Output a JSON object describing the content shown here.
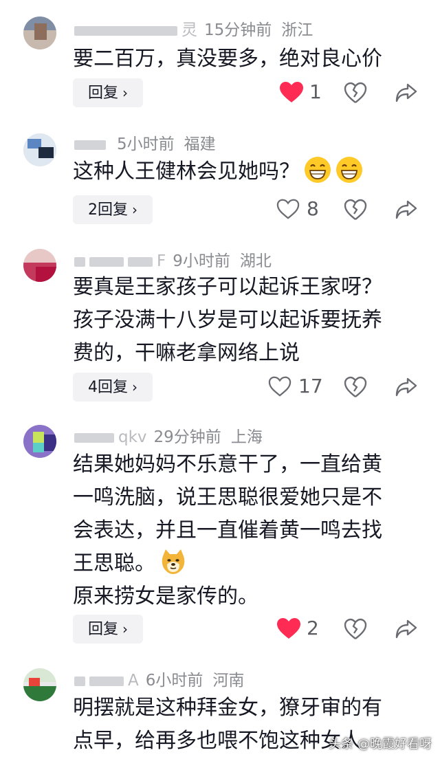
{
  "comments": [
    {
      "name_tail": "灵",
      "time": "15分钟前",
      "location": "浙江",
      "lines": [
        "要二百万，真没要多，绝对良心价"
      ],
      "reply_label": "回复",
      "likes": "1",
      "liked": true
    },
    {
      "name_tail": "",
      "time": "5小时前",
      "location": "福建",
      "lines": [
        "这种人王健林会见她吗？"
      ],
      "emoji": "grin-emoji",
      "reply_label": "2回复",
      "likes": "8",
      "liked": false
    },
    {
      "name_tail": "F",
      "time": "9小时前",
      "location": "湖北",
      "lines": [
        "要真是王家孩子可以起诉王家呀？",
        "孩子没满十八岁是可以起诉要抚养",
        "费的，干嘛老拿网络上说"
      ],
      "reply_label": "4回复",
      "likes": "17",
      "liked": false
    },
    {
      "name_tail": "qkv",
      "time": "29分钟前",
      "location": "上海",
      "lines": [
        "结果她妈妈不乐意干了，一直给黄",
        "一鸣洗脑，说王思聪很爱她只是不",
        "会表达，并且一直催着黄一鸣去找",
        "王思聪。",
        "原来捞女是家传的。"
      ],
      "emoji": "doge-emoji",
      "reply_label": "回复",
      "likes": "2",
      "liked": true
    },
    {
      "name_tail": "A",
      "time": "6小时前",
      "location": "河南",
      "lines": [
        "明摆就是这种拜金女，獠牙审的有",
        "点早，给再多也喂不饱这种女人"
      ],
      "reply_label": "",
      "likes": "",
      "liked": false
    }
  ],
  "watermark": "头条 @晚霞好看呀",
  "colors": {
    "like_red": "#fe2c55",
    "text": "#161823",
    "meta": "#8a8b91"
  }
}
